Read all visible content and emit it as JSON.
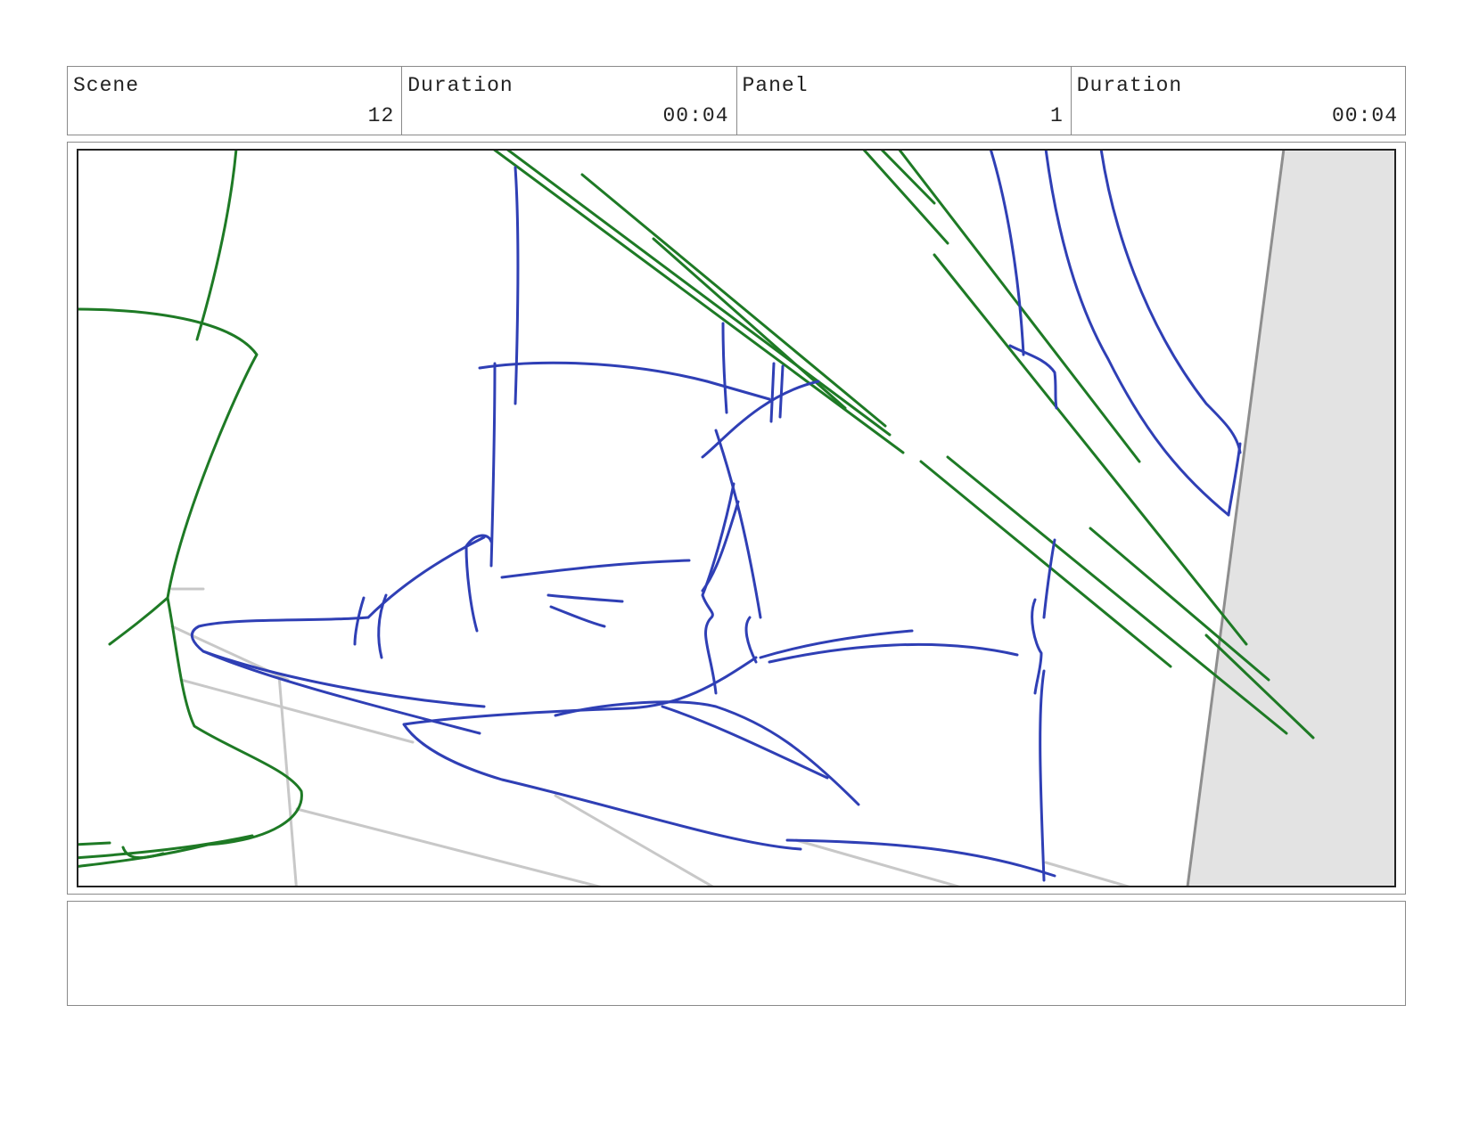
{
  "header": {
    "scene_label": "Scene",
    "scene_value": "12",
    "scene_duration_label": "Duration",
    "scene_duration_value": "00:04",
    "panel_label": "Panel",
    "panel_value": "1",
    "panel_duration_label": "Duration",
    "panel_duration_value": "00:04"
  },
  "notes": {
    "text": ""
  },
  "colors": {
    "blue_stroke": "#2f3fb5",
    "green_stroke": "#1e7a25",
    "grey_guide": "#c8c8c8",
    "wall_fill": "#e3e3e3"
  }
}
